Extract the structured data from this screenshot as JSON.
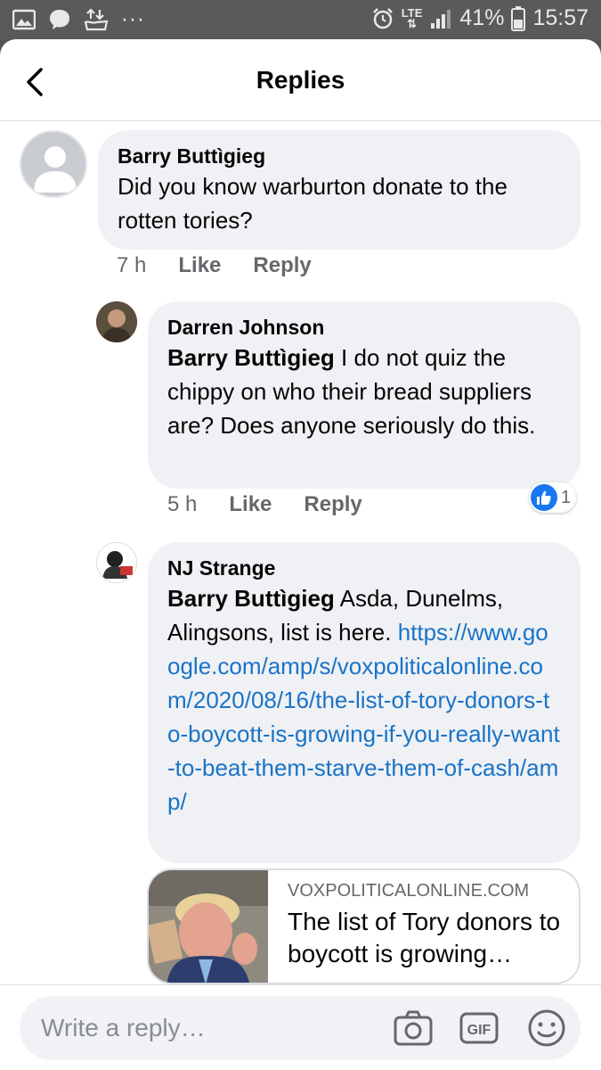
{
  "status_bar": {
    "battery_pct": "41%",
    "time": "15:57",
    "network": "LTE",
    "dots": "···"
  },
  "header": {
    "title": "Replies"
  },
  "comments": [
    {
      "author": "Barry Buttìgieg",
      "text": "Did you know warburton donate to the rotten tories?",
      "time": "7 h",
      "like_label": "Like",
      "reply_label": "Reply"
    },
    {
      "author": "Darren Johnson",
      "mention": "Barry Buttìgieg",
      "text": "I do not quiz the chippy on who their bread suppliers are? Does anyone seriously do this.",
      "time": "5 h",
      "like_label": "Like",
      "reply_label": "Reply",
      "reaction_count": "1"
    },
    {
      "author": "NJ Strange",
      "mention": "Barry Buttìgieg",
      "text": " Asda, Dunelms, Alingsons, list is here.",
      "link": "https://www.google.com/amp/s/voxpoliticalonline.com/2020/08/16/the-list-of-tory-donors-to-boycott-is-growing-if-you-really-want-to-beat-them-starve-them-of-cash/amp/"
    }
  ],
  "link_preview": {
    "domain": "VOXPOLITICALONLINE.COM",
    "title": "The list of Tory donors to boycott is growing…"
  },
  "composer": {
    "placeholder": "Write a reply…"
  },
  "colors": {
    "link": "#1a73c8",
    "like_blue": "#1877f2",
    "bubble": "#eff1f4"
  }
}
